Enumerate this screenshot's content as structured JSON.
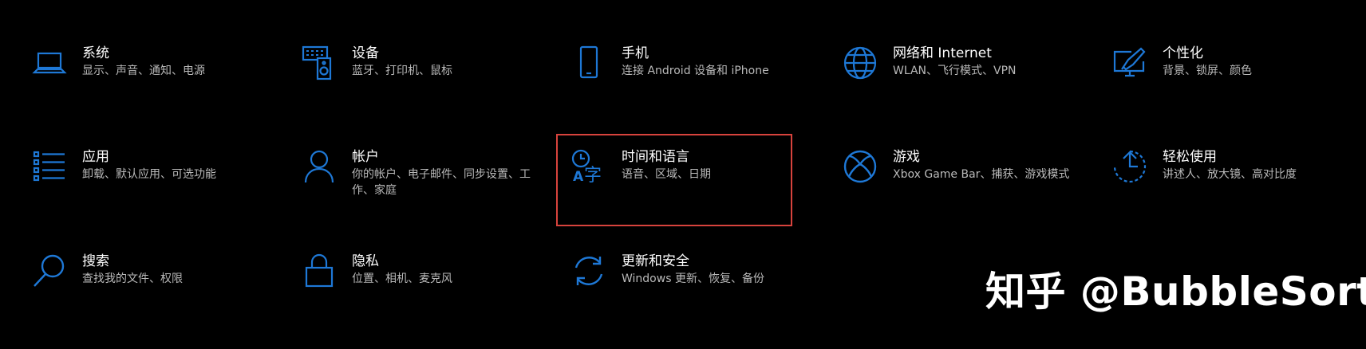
{
  "colors": {
    "background": "#000000",
    "accent": "#1e78d6",
    "highlight": "#d7433d",
    "description": "#b9b9b9"
  },
  "categories": [
    {
      "title": "系统",
      "desc": "显示、声音、通知、电源",
      "icon": "laptop-icon"
    },
    {
      "title": "设备",
      "desc": "蓝牙、打印机、鼠标",
      "icon": "devices-icon"
    },
    {
      "title": "手机",
      "desc": "连接 Android 设备和 iPhone",
      "icon": "phone-icon"
    },
    {
      "title": "网络和 Internet",
      "desc": "WLAN、飞行模式、VPN",
      "icon": "globe-icon"
    },
    {
      "title": "个性化",
      "desc": "背景、锁屏、颜色",
      "icon": "paint-monitor-icon"
    },
    {
      "title": "应用",
      "desc": "卸载、默认应用、可选功能",
      "icon": "apps-list-icon"
    },
    {
      "title": "帐户",
      "desc": "你的帐户、电子邮件、同步设置、工作、家庭",
      "icon": "person-icon"
    },
    {
      "title": "时间和语言",
      "desc": "语音、区域、日期",
      "icon": "time-language-icon"
    },
    {
      "title": "游戏",
      "desc": "Xbox Game Bar、捕获、游戏模式",
      "icon": "xbox-icon"
    },
    {
      "title": "轻松使用",
      "desc": "讲述人、放大镜、高对比度",
      "icon": "ease-of-access-icon"
    },
    {
      "title": "搜索",
      "desc": "查找我的文件、权限",
      "icon": "search-icon"
    },
    {
      "title": "隐私",
      "desc": "位置、相机、麦克风",
      "icon": "lock-icon"
    },
    {
      "title": "更新和安全",
      "desc": "Windows 更新、恢复、备份",
      "icon": "sync-icon"
    }
  ],
  "watermark": "知乎 @BubbleSort"
}
